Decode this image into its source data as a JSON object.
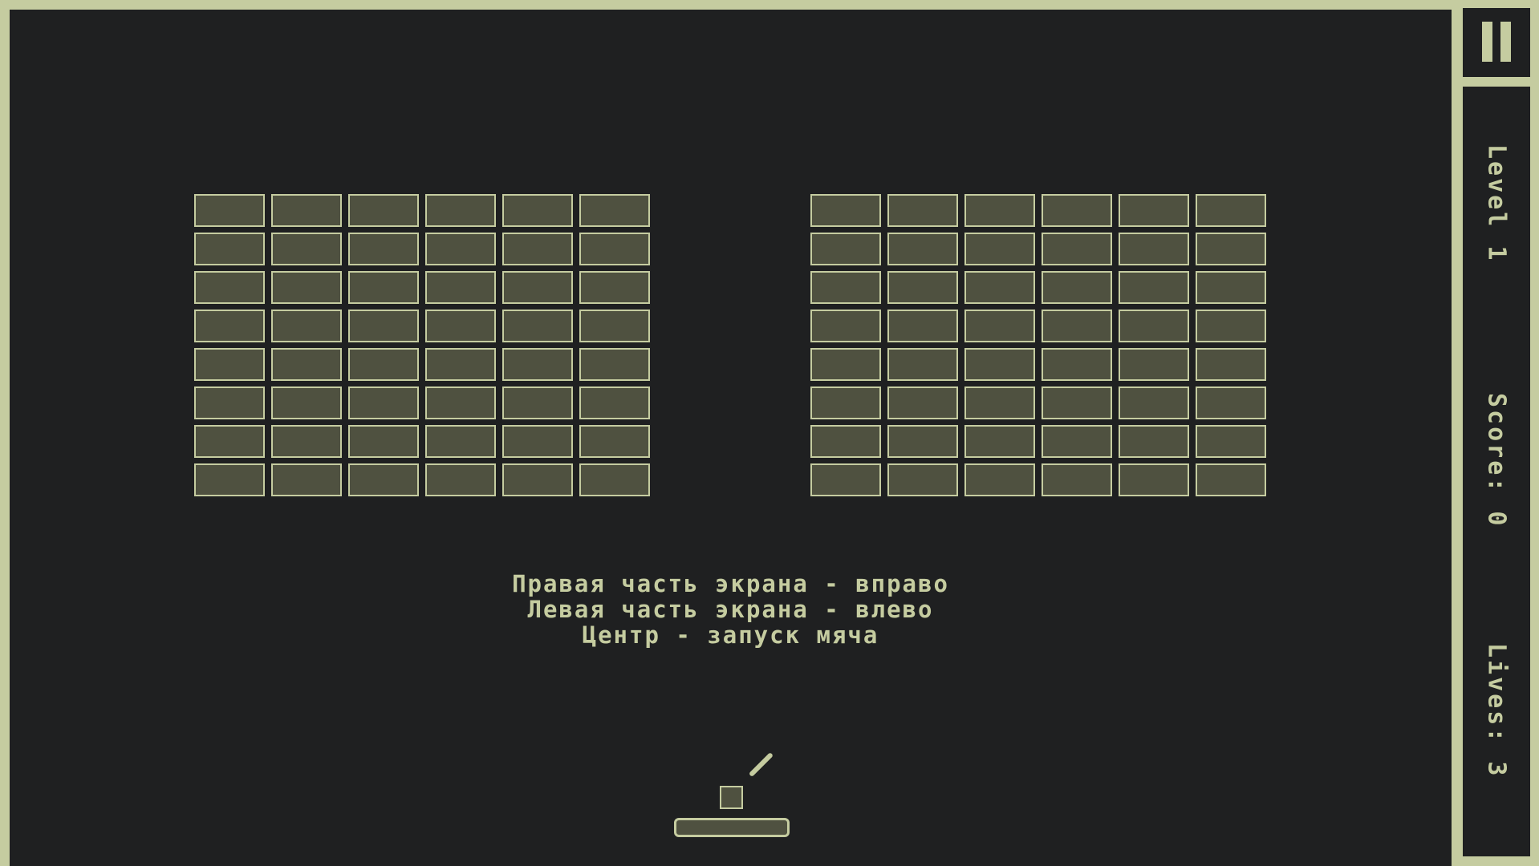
{
  "hud": {
    "level": "Level 1",
    "score": "Score: 0",
    "lives": "Lives: 3",
    "pause_icon": "pause-icon"
  },
  "instructions": [
    "Правая часть экрана - вправо",
    "Левая часть экрана - влево",
    "Центр - запуск мяча"
  ],
  "bricks": {
    "left_block": {
      "rows": 8,
      "columns": 6
    },
    "right_block": {
      "rows": 8,
      "columns": 6
    }
  },
  "colors": {
    "frame": "#c5cca0",
    "background": "#1f2021",
    "brick_fill": "#4f5140"
  }
}
